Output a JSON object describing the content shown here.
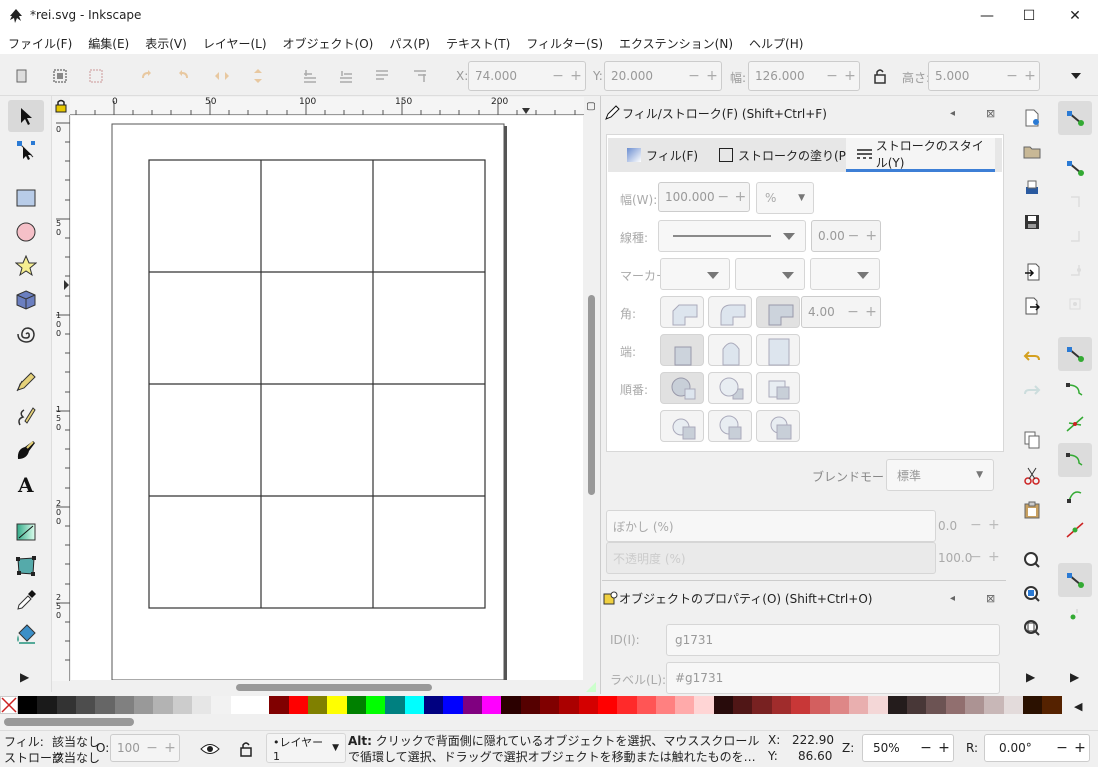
{
  "window": {
    "title": "*rei.svg - Inkscape",
    "minimize": "—",
    "maximize": "☐",
    "close": "✕"
  },
  "menu": [
    "ファイル(F)",
    "編集(E)",
    "表示(V)",
    "レイヤー(L)",
    "オブジェクト(O)",
    "パス(P)",
    "テキスト(T)",
    "フィルター(S)",
    "エクステンション(N)",
    "ヘルプ(H)"
  ],
  "coords": {
    "x_label": "X:",
    "x_value": "74.000",
    "y_label": "Y:",
    "y_value": "20.000",
    "w_label": "幅:",
    "w_value": "126.000",
    "h_label": "高さ:",
    "h_value": "5.000"
  },
  "ruler": {
    "h_ticks": [
      "0",
      "50",
      "100",
      "150",
      "200"
    ],
    "v_ticks": [
      "0",
      "5 0",
      "1 0 0",
      "1 5 0",
      "2 0 0",
      "2 5 0"
    ]
  },
  "fill_stroke": {
    "title": "フィル/ストローク(F) (Shift+Ctrl+F)",
    "tabs": [
      "フィル(F)",
      "ストロークの塗り(P)",
      "ストロークのスタイル(Y)"
    ],
    "width_label": "幅(W):",
    "width_value": "100.000",
    "width_unit": "%",
    "dash_label": "線種:",
    "dash_offset": "0.00",
    "marker_label": "マーカー:",
    "join_label": "角:",
    "miter_value": "4.00",
    "cap_label": "端:",
    "order_label": "順番:",
    "blend_label": "ブレンドモード:",
    "blend_value": "標準",
    "blur_label": "ぼかし (%)",
    "blur_value": "0.0",
    "opacity_label": "不透明度 (%)",
    "opacity_value": "100.0"
  },
  "object_props": {
    "title": "オブジェクトのプロパティ(O) (Shift+Ctrl+O)",
    "id_label": "ID(I):",
    "id_value": "g1731",
    "label_label": "ラベル(L):",
    "label_value": "#g1731"
  },
  "status": {
    "fill_label": "フィル:",
    "fill_value": "該当なし",
    "stroke_label": "ストローク:",
    "stroke_value": "該当なし",
    "opacity_label": "O:",
    "opacity_value": "100",
    "layer_value": "•レイヤー 1",
    "message_bold": "Alt:",
    "message": " クリックで背面側に隠れているオブジェクトを選択、マウススクロールで循環して選択、ドラッグで選択オブジェクトを移動または触れたものを…",
    "cursor_x_label": "X:",
    "cursor_x": "222.90",
    "cursor_y_label": "Y:",
    "cursor_y": "86.60",
    "zoom_label": "Z:",
    "zoom_value": "50%",
    "rotate_label": "R:",
    "rotate_value": "0.00°"
  },
  "palette": [
    "#000000",
    "#1a1a1a",
    "#333333",
    "#4d4d4d",
    "#666666",
    "#808080",
    "#999999",
    "#b3b3b3",
    "#cccccc",
    "#e6e6e6",
    "#f2f2f2",
    "#ffffff",
    "#ffffff",
    "#800000",
    "#ff0000",
    "#808000",
    "#ffff00",
    "#008000",
    "#00ff00",
    "#008080",
    "#00ffff",
    "#000080",
    "#0000ff",
    "#800080",
    "#ff00ff",
    "#2b0000",
    "#550000",
    "#800000",
    "#aa0000",
    "#d40000",
    "#ff0000",
    "#ff2a2a",
    "#ff5555",
    "#ff8080",
    "#ffaaaa",
    "#ffd5d5",
    "#280b0b",
    "#501616",
    "#782121",
    "#a02c2c",
    "#c83737",
    "#d35f5f",
    "#de8787",
    "#e9afaf",
    "#f4d7d7",
    "#241c1c",
    "#483737",
    "#6c5353",
    "#916f6f",
    "#ac9393",
    "#c8b7b7",
    "#e3dbdb",
    "#2b1100",
    "#552200"
  ]
}
